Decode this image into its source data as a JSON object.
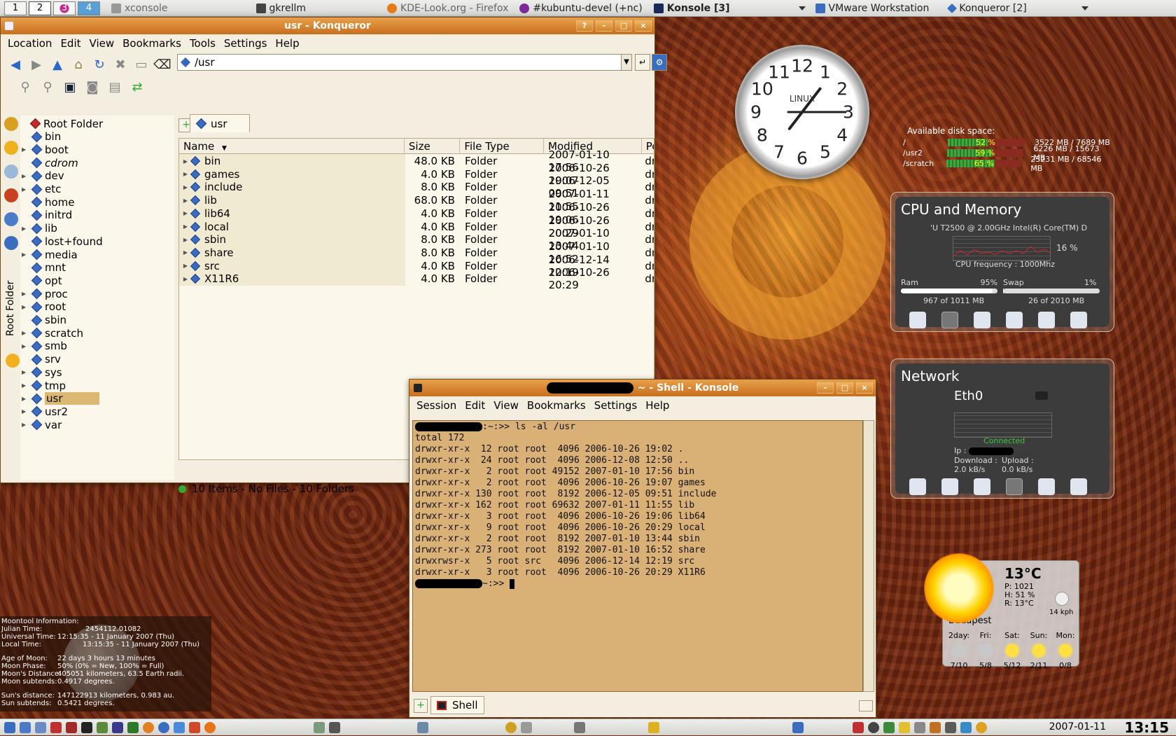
{
  "taskbar": {
    "desktops": [
      "1",
      "2",
      "3",
      "4"
    ],
    "tasks": [
      {
        "label": "xconsole"
      },
      {
        "label": "gkrellm"
      },
      {
        "label": "KDE-Look.org - Firefox"
      },
      {
        "label": "#kubuntu-devel (+nc)"
      },
      {
        "label": "Konsole [3]"
      },
      {
        "label": "VMware Workstation"
      },
      {
        "label": "Konqueror [2]"
      }
    ]
  },
  "konqueror": {
    "title": "usr - Konqueror",
    "titlebar_buttons": [
      "?",
      "–",
      "□",
      "×"
    ],
    "menu": [
      "Location",
      "Edit",
      "View",
      "Bookmarks",
      "Tools",
      "Settings",
      "Help"
    ],
    "location": "/usr",
    "sidebar_title": "Root Folder",
    "tree": [
      {
        "label": "Root Folder",
        "expandable": false,
        "root": true
      },
      {
        "label": "bin",
        "expandable": false
      },
      {
        "label": "boot",
        "expandable": true
      },
      {
        "label": "cdrom",
        "expandable": false,
        "italic": true
      },
      {
        "label": "dev",
        "expandable": true
      },
      {
        "label": "etc",
        "expandable": true
      },
      {
        "label": "home",
        "expandable": false
      },
      {
        "label": "initrd",
        "expandable": false
      },
      {
        "label": "lib",
        "expandable": true
      },
      {
        "label": "lost+found",
        "expandable": false
      },
      {
        "label": "media",
        "expandable": true
      },
      {
        "label": "mnt",
        "expandable": false
      },
      {
        "label": "opt",
        "expandable": false
      },
      {
        "label": "proc",
        "expandable": true
      },
      {
        "label": "root",
        "expandable": true
      },
      {
        "label": "sbin",
        "expandable": false
      },
      {
        "label": "scratch",
        "expandable": true
      },
      {
        "label": "smb",
        "expandable": true
      },
      {
        "label": "srv",
        "expandable": false
      },
      {
        "label": "sys",
        "expandable": true
      },
      {
        "label": "tmp",
        "expandable": true
      },
      {
        "label": "usr",
        "expandable": true,
        "selected": true
      },
      {
        "label": "usr2",
        "expandable": true
      },
      {
        "label": "var",
        "expandable": true
      }
    ],
    "tab_label": "usr",
    "columns": [
      "Name",
      "Size",
      "File Type",
      "Modified",
      "Pe"
    ],
    "files": [
      {
        "name": "bin",
        "size": "48.0 KB",
        "type": "Folder",
        "modified": "2007-01-10 17:56",
        "perm": "dr"
      },
      {
        "name": "games",
        "size": "4.0 KB",
        "type": "Folder",
        "modified": "2006-10-26 19:07",
        "perm": "dr"
      },
      {
        "name": "include",
        "size": "8.0 KB",
        "type": "Folder",
        "modified": "2006-12-05 09:51",
        "perm": "dr"
      },
      {
        "name": "lib",
        "size": "68.0 KB",
        "type": "Folder",
        "modified": "2007-01-11 11:55",
        "perm": "dr"
      },
      {
        "name": "lib64",
        "size": "4.0 KB",
        "type": "Folder",
        "modified": "2006-10-26 19:06",
        "perm": "dr"
      },
      {
        "name": "local",
        "size": "4.0 KB",
        "type": "Folder",
        "modified": "2006-10-26 20:29",
        "perm": "dr"
      },
      {
        "name": "sbin",
        "size": "8.0 KB",
        "type": "Folder",
        "modified": "2007-01-10 13:44",
        "perm": "dr"
      },
      {
        "name": "share",
        "size": "8.0 KB",
        "type": "Folder",
        "modified": "2007-01-10 16:52",
        "perm": "dr"
      },
      {
        "name": "src",
        "size": "4.0 KB",
        "type": "Folder",
        "modified": "2006-12-14 12:19",
        "perm": "dr"
      },
      {
        "name": "X11R6",
        "size": "4.0 KB",
        "type": "Folder",
        "modified": "2006-10-26 20:29",
        "perm": "dr"
      }
    ],
    "status": "10 Items - No Files - 10 Folders"
  },
  "konsole": {
    "title": "~ - Shell - Konsole",
    "menu": [
      "Session",
      "Edit",
      "View",
      "Bookmarks",
      "Settings",
      "Help"
    ],
    "prompt_suffix": ":~:>> ",
    "command": "ls -al /usr",
    "output": [
      "total 172",
      "drwxr-xr-x  12 root root  4096 2006-10-26 19:02 .",
      "drwxr-xr-x  24 root root  4096 2006-12-08 12:50 ..",
      "drwxr-xr-x   2 root root 49152 2007-01-10 17:56 bin",
      "drwxr-xr-x   2 root root  4096 2006-10-26 19:07 games",
      "drwxr-xr-x 130 root root  8192 2006-12-05 09:51 include",
      "drwxr-xr-x 162 root root 69632 2007-01-11 11:55 lib",
      "drwxr-xr-x   3 root root  4096 2006-10-26 19:06 lib64",
      "drwxr-xr-x   9 root root  4096 2006-10-26 20:29 local",
      "drwxr-xr-x   2 root root  8192 2007-01-10 13:44 sbin",
      "drwxr-xr-x 273 root root  8192 2007-01-10 16:52 share",
      "drwxrwsr-x   5 root src   4096 2006-12-14 12:19 src",
      "drwxr-xr-x   3 root root  4096 2006-10-26 20:29 X11R6"
    ],
    "prompt2_suffix": "~:>> ",
    "tab_label": "Shell"
  },
  "clock": {
    "brand": "LINUX",
    "numbers": [
      "12",
      "1",
      "2",
      "3",
      "4",
      "5",
      "6",
      "7",
      "8",
      "9",
      "10",
      "11"
    ],
    "hour": 1.25,
    "minute": 15
  },
  "disk": {
    "title": "Available disk space:",
    "mounts": [
      {
        "name": "/",
        "percent_label": "52 %",
        "used_fraction": 0.52,
        "detail": "3522 MB / 7689 MB"
      },
      {
        "name": "/usr2",
        "percent_label": "59 %",
        "used_fraction": 0.59,
        "detail": "6226 MB / 15673 MB"
      },
      {
        "name": "/scratch",
        "percent_label": "65 %",
        "used_fraction": 0.65,
        "detail": "23231 MB / 68546 MB"
      }
    ]
  },
  "cpu": {
    "title": "CPU and Memory",
    "model": "'U T2500 @ 2.00GHz Intel(R) Core(TM) D",
    "load": "16 %",
    "frequency": "CPU frequency : 1000Mhz",
    "ram_label": "Ram",
    "ram_pct": "95%",
    "ram_fraction": 0.95,
    "ram_detail": "967 of 1011 MB",
    "swap_label": "Swap",
    "swap_pct": "1%",
    "swap_fraction": 0.01,
    "swap_detail": "26 of 2010 MB"
  },
  "network": {
    "title": "Network",
    "iface": "Eth0",
    "status": "Connected",
    "ip_label": "Ip :",
    "download_label": "Download :",
    "download": "2.0 kB/s",
    "upload_label": "Upload :",
    "upload": "0.0 kB/s"
  },
  "weather": {
    "temp": "13°C",
    "pressure": "P: 1021",
    "humidity": "H: 51 %",
    "realfeel": "R: 13°C",
    "wind": "14 kph",
    "city": "Budapest",
    "days": [
      {
        "name": "2day:",
        "range": "7/10",
        "icon": "cloud"
      },
      {
        "name": "Fri:",
        "range": "5/8",
        "icon": "cloud"
      },
      {
        "name": "Sat:",
        "range": "5/12",
        "icon": "sun"
      },
      {
        "name": "Sun:",
        "range": "2/11",
        "icon": "sun"
      },
      {
        "name": "Mon:",
        "range": "0/8",
        "icon": "sun"
      }
    ]
  },
  "moontool": {
    "rows": [
      {
        "k": "Moontool Information:",
        "v": ""
      },
      {
        "k": "Julian Time:",
        "v": "2454112.01082"
      },
      {
        "k": "Universal Time:",
        "v": "12:15:35 - 11 January 2007 (Thu)"
      },
      {
        "k": "Local Time:",
        "v": "13:15:35 - 11 January 2007 (Thu)"
      },
      {
        "k": "",
        "v": ""
      },
      {
        "k": "Age of Moon:",
        "v": "22 days 3 hours 13 minutes"
      },
      {
        "k": "Moon Phase:",
        "v": "50% (0% = New, 100% = Full)"
      },
      {
        "k": "Moon's Distance:",
        "v": "405051 kilometers, 63.5 Earth radii."
      },
      {
        "k": "Moon subtends:",
        "v": "0.4917 degrees."
      },
      {
        "k": "",
        "v": ""
      },
      {
        "k": "Sun's distance:",
        "v": "147122913 kilometers, 0.983 au."
      },
      {
        "k": "Sun subtends:",
        "v": "0.5421 degrees."
      }
    ]
  },
  "clockbar": {
    "date": "2007-01-11",
    "time": "13:15"
  }
}
